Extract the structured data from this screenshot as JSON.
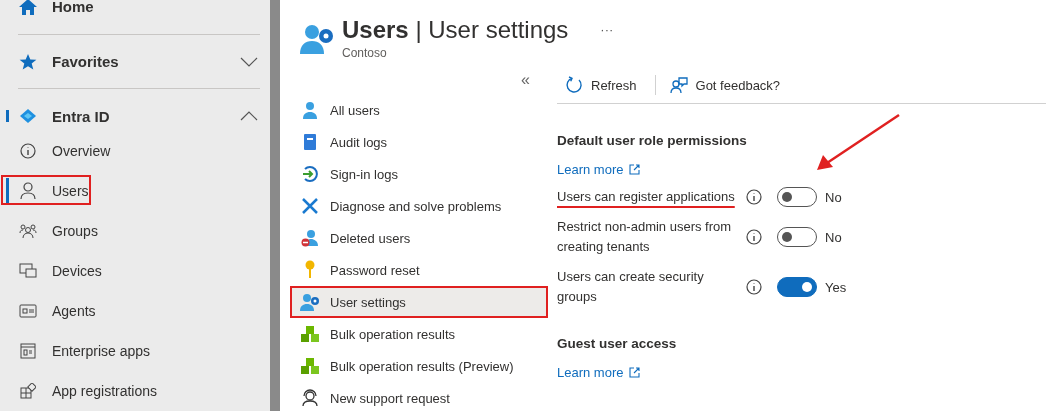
{
  "sidebar": {
    "home": {
      "label": "Home"
    },
    "sections": [
      {
        "label": "Favorites",
        "expanded": false,
        "selected": false
      },
      {
        "label": "Entra ID",
        "expanded": true,
        "selected": true,
        "children": [
          {
            "label": "Overview",
            "selected": false,
            "highlighted": false
          },
          {
            "label": "Users",
            "selected": true,
            "highlighted": true
          },
          {
            "label": "Groups",
            "selected": false,
            "highlighted": false
          },
          {
            "label": "Devices",
            "selected": false,
            "highlighted": false
          },
          {
            "label": "Agents",
            "selected": false,
            "highlighted": false
          },
          {
            "label": "Enterprise apps",
            "selected": false,
            "highlighted": false
          },
          {
            "label": "App registrations",
            "selected": false,
            "highlighted": false
          }
        ]
      }
    ]
  },
  "blade": {
    "title": "**Users** | User settings",
    "subtitle": "Contoso",
    "more": "···",
    "collapse": "«",
    "menu": [
      {
        "label": "All users",
        "selected": false,
        "highlighted": false
      },
      {
        "label": "Audit logs",
        "selected": false,
        "highlighted": false
      },
      {
        "label": "Sign-in logs",
        "selected": false,
        "highlighted": false
      },
      {
        "label": "Diagnose and solve problems",
        "selected": false,
        "highlighted": false
      },
      {
        "label": "Deleted users",
        "selected": false,
        "highlighted": false
      },
      {
        "label": "Password reset",
        "selected": false,
        "highlighted": false
      },
      {
        "label": "User settings",
        "selected": true,
        "highlighted": true
      },
      {
        "label": "Bulk operation results",
        "selected": false,
        "highlighted": false
      },
      {
        "label": "Bulk operation results (Preview)",
        "selected": false,
        "highlighted": false
      },
      {
        "label": "New support request",
        "selected": false,
        "highlighted": false
      }
    ]
  },
  "toolbar": [
    {
      "label": "Refresh"
    },
    {
      "label": "Got feedback?"
    }
  ],
  "sections": [
    {
      "heading": "Default user role permissions",
      "link": "Learn more",
      "settings": [
        {
          "label": "Users can register applications",
          "on": false,
          "state": "No",
          "underlined": true,
          "arrow": true
        },
        {
          "label": "Restrict non-admin users from creating tenants",
          "on": false,
          "state": "No",
          "underlined": false,
          "arrow": false
        },
        {
          "label": "Users can create security groups",
          "on": true,
          "state": "Yes",
          "underlined": false,
          "arrow": false
        }
      ]
    },
    {
      "heading": "Guest user access",
      "link": "Learn more"
    }
  ]
}
